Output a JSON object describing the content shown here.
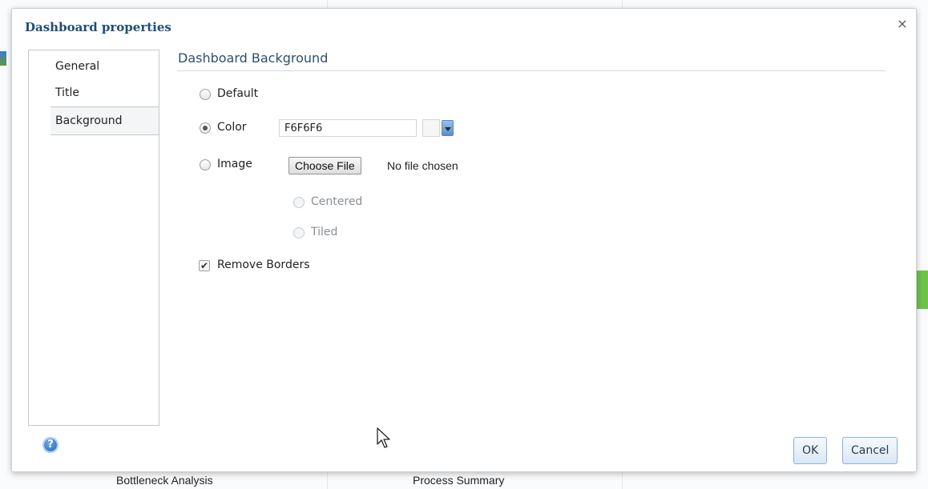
{
  "background_app": {
    "labels": [
      "Bottleneck Analysis",
      "Process Summary"
    ]
  },
  "dialog": {
    "title": "Dashboard properties",
    "close_glyph": "×",
    "nav": {
      "items": [
        {
          "label": "General",
          "selected": false
        },
        {
          "label": "Title",
          "selected": false
        },
        {
          "label": "Background",
          "selected": true
        }
      ]
    },
    "section": {
      "title": "Dashboard Background",
      "options": {
        "default_label": "Default",
        "color_label": "Color",
        "image_label": "Image",
        "centered_label": "Centered",
        "tiled_label": "Tiled",
        "selected": "Color"
      },
      "color": {
        "value": "F6F6F6",
        "swatch": "#F6F6F6"
      },
      "file": {
        "button_label": "Choose File",
        "status": "No file chosen"
      },
      "remove_borders": {
        "label": "Remove Borders",
        "checked": true,
        "check_glyph": "✔"
      }
    },
    "footer": {
      "help_glyph": "?",
      "ok_label": "OK",
      "cancel_label": "Cancel"
    }
  },
  "colors": {
    "title": "#1f4e79",
    "accent_button_border": "#8db2d9"
  }
}
